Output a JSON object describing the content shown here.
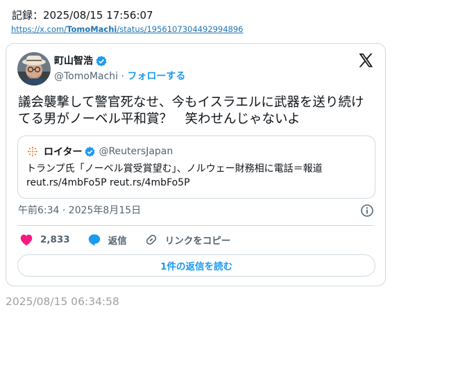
{
  "record": {
    "text": "記録：2025/08/15 17:56:07"
  },
  "source": {
    "prefix": "https://x.com/",
    "user": "TomoMachi",
    "suffix": "/status/1956107304492994896"
  },
  "tweet": {
    "display_name": "町山智浩",
    "handle": "@TomoMachi",
    "separator": "·",
    "follow_label": "フォローする",
    "text": "議会襲撃して警官死なせ、今もイスラエルに武器を送り続けてる男がノーベル平和賞？　笑わせんじゃないよ",
    "timestamp": "午前6:34 · 2025年8月15日",
    "likes": "2,833",
    "reply_label": "返信",
    "copy_link_label": "リンクをコピー",
    "read_replies_label": "1件の返信を読む"
  },
  "quoted": {
    "name": "ロイター",
    "handle": "@ReutersJapan",
    "line1": "トランプ氏「ノーベル賞受賞望む」、ノルウェー財務相に電話＝報道",
    "line2": "reut.rs/4mbFo5P reut.rs/4mbFo5P"
  },
  "footer": {
    "time": "2025/08/15 06:34:58"
  },
  "colors": {
    "accent": "#1d9bf0",
    "like": "#f91880",
    "muted": "#536471",
    "border": "#cfd9de"
  },
  "icons": [
    "verified-badge-icon",
    "x-logo-icon",
    "info-icon",
    "heart-icon",
    "reply-bubble-icon",
    "link-icon",
    "reuters-logo-icon"
  ]
}
